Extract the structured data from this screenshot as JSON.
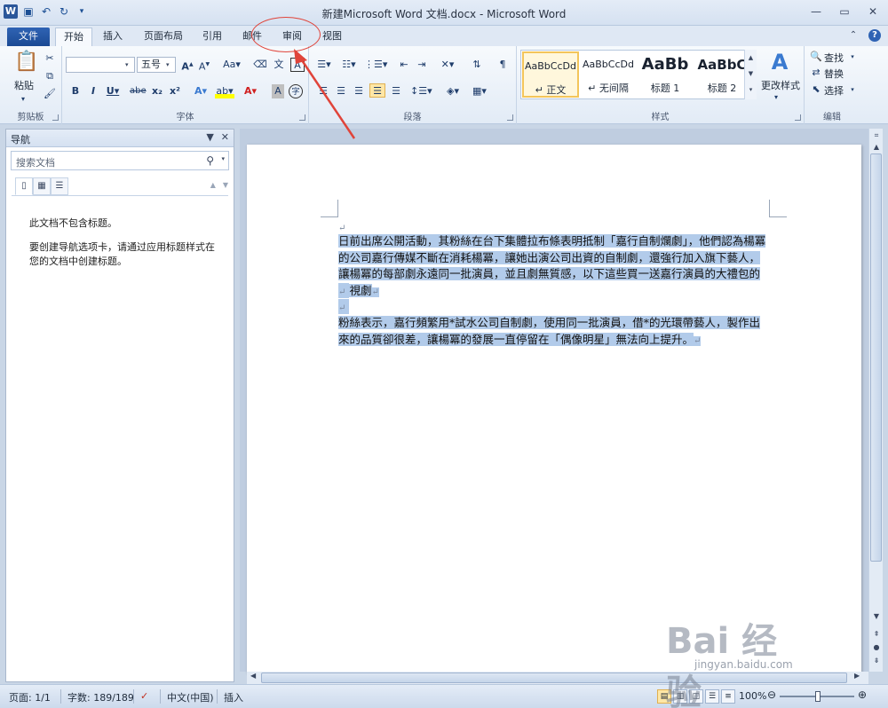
{
  "window": {
    "title": "新建Microsoft Word 文档.docx  -  Microsoft Word",
    "controls": [
      "minimize",
      "restore",
      "close"
    ]
  },
  "qat": {
    "icons": [
      "word-icon",
      "save-icon",
      "undo-icon",
      "redo-icon",
      "customize-icon"
    ]
  },
  "tabs": [
    {
      "label": "文件"
    },
    {
      "label": "开始"
    },
    {
      "label": "插入"
    },
    {
      "label": "页面布局"
    },
    {
      "label": "引用"
    },
    {
      "label": "邮件"
    },
    {
      "label": "审阅"
    },
    {
      "label": "视图"
    }
  ],
  "ribbon": {
    "clipboard": {
      "paste": "粘贴",
      "label": "剪贴板"
    },
    "font": {
      "name_value": "",
      "size_value": "五号",
      "label": "字体",
      "buttons": [
        "B",
        "I",
        "U",
        "abe",
        "x₂",
        "x²",
        "A",
        "A",
        "A",
        "A"
      ]
    },
    "paragraph": {
      "label": "段落"
    },
    "styles": {
      "label": "样式",
      "tiles": [
        {
          "sample": "AaBbCcDd",
          "name": "↵ 正文"
        },
        {
          "sample": "AaBbCcDd",
          "name": "↵ 无间隔"
        },
        {
          "sample": "AaBb",
          "name": "标题 1"
        },
        {
          "sample": "AaBbC",
          "name": "标题 2"
        }
      ],
      "change": "更改样式"
    },
    "editing": {
      "label": "编辑",
      "find": "查找",
      "replace": "替换",
      "select": "选择"
    }
  },
  "nav": {
    "title": "导航",
    "search_placeholder": "搜索文档",
    "empty_line1": "此文档不包含标题。",
    "empty_line2": "要创建导航选项卡，请通过应用标题样式在您的文档中创建标题。"
  },
  "document": {
    "para1": "日前出席公開活動，其粉絲在台下集體拉布條表明抵制「嘉行自制爛劇」，他們認為楊冪的公司嘉行傳媒不斷在消耗楊冪，讓她出演公司出資的自制劇，還強行加入旗下藝人，讓楊冪的每部劇永遠同一批演員，並且劇無質感，以下這些買一送嘉行演員的大禮包的電視劇",
    "para2": "粉絲表示，嘉行頻繁用*試水公司自制劇，使用同一批演員，借*的光環帶藝人，製作出來的品質卻很差，讓楊冪的發展一直停留在「偶像明星」無法向上提升。"
  },
  "status": {
    "page": "页面: 1/1",
    "words": "字数: 189/189",
    "lang": "中文(中国)",
    "mode": "插入",
    "zoom": "100%",
    "zoom_level": 1.0
  },
  "watermark": {
    "main": "Bai 经验",
    "sub": "jingyan.baidu.com"
  },
  "colors": {
    "accent": "#2b579a",
    "annotation": "#e0443a",
    "selection": "#b2cbea"
  }
}
